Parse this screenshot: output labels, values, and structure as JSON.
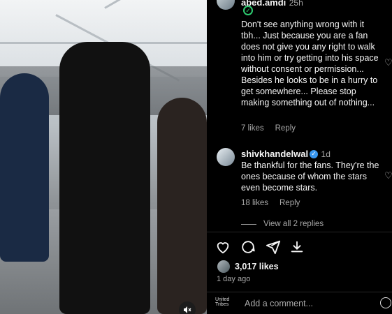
{
  "comments": [
    {
      "username": "abed.amdi",
      "time": "25h",
      "text": "Don't see anything wrong with it tbh... Just because you are a fan does not give you any right to walk into him or try getting into his space without consent or permission... Besides he looks to be in a hurry to get somewhere... Please stop making something out of nothing...",
      "likes": "7 likes",
      "reply": "Reply"
    },
    {
      "username": "shivkhandelwal",
      "time": "1d",
      "text": "Be thankful for the fans. They're the ones because of whom the stars even become stars.",
      "likes": "18 likes",
      "reply": "Reply"
    }
  ],
  "view_replies": "View all 2 replies",
  "post": {
    "likes": "3,017 likes",
    "ago": "1 day ago"
  },
  "comment_box": {
    "placeholder": "Add a comment...",
    "avatar_text": "United Tribes"
  },
  "icons": [
    "heart-icon",
    "comment-icon",
    "share-icon",
    "save-icon",
    "mute-icon",
    "emoji-icon"
  ]
}
